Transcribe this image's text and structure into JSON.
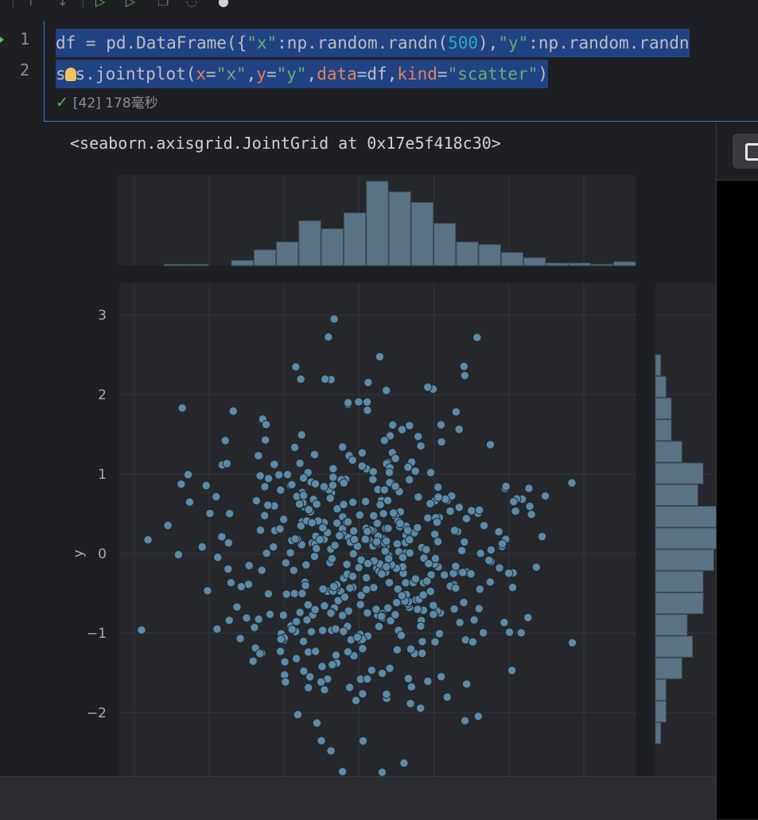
{
  "code": {
    "line_numbers": [
      "1",
      "2"
    ],
    "line1": {
      "p1": "df = pd.DataFrame({",
      "s1": "\"x\"",
      "p2": ":np.random.randn(",
      "n1": "500",
      "p3": "),",
      "s2": "\"y\"",
      "p4": ":np.random.randn"
    },
    "line2": {
      "p1a": "s",
      "p1b": "s.jointplot(",
      "k1": "x",
      "p2": "=",
      "s1": "\"x\"",
      "p3": ",",
      "k2": "y",
      "p4": "=",
      "s2": "\"y\"",
      "p5": ",",
      "k3": "data",
      "p6": "=df,",
      "k4": "kind",
      "p7": "=",
      "s3": "\"scatter\"",
      "p8": ")"
    },
    "status": "[42] 178毫秒"
  },
  "output_text": "<seaborn.axisgrid.JointGrid at 0x17e5f418c30>",
  "chart_data": {
    "type": "scatter",
    "title": "",
    "xlabel": "",
    "ylabel": "y",
    "yticks": [
      "3",
      "2",
      "1",
      "0",
      "−1",
      "−2"
    ],
    "ylim": [
      -2.8,
      3.4
    ],
    "xlim": [
      -3.2,
      3.7
    ],
    "n_points": 500,
    "marker_color": "#5d8aa6",
    "bar_color": "#5a7385",
    "background": "#1e1f22",
    "grid": true,
    "x_hist_counts": [
      0,
      0.5,
      0.5,
      0,
      2,
      6,
      9,
      17,
      14,
      20,
      32,
      28,
      24,
      16,
      9,
      8,
      5,
      3,
      1,
      1,
      0.5,
      1.5
    ],
    "y_hist_counts": [
      1,
      2,
      3,
      3,
      5,
      9,
      8,
      12,
      12,
      11,
      9,
      9,
      6,
      7,
      5,
      2,
      2,
      1
    ]
  },
  "colors": {
    "accent": "#3574f0",
    "success": "#5fb865",
    "selection": "#214283"
  }
}
